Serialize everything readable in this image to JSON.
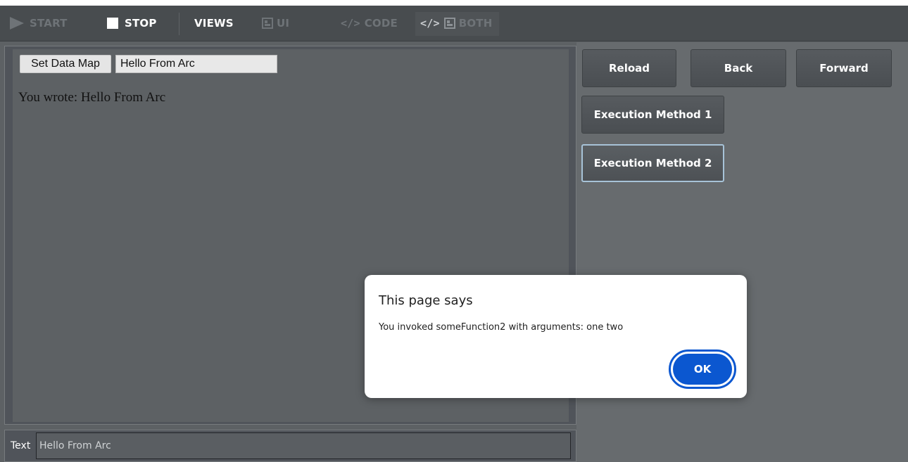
{
  "toolbar": {
    "start_label": "START",
    "stop_label": "STOP",
    "views_label": "VIEWS",
    "ui_label": "UI",
    "code_label": "CODE",
    "both_label": "BOTH",
    "code_glyph": "</>",
    "icons": [
      "play-icon",
      "stop-icon",
      "ui-layout-icon",
      "code-icon"
    ]
  },
  "web_view": {
    "set_button_label": "Set Data Map",
    "input_value": "Hello From Arc",
    "output_text": "You wrote: Hello From Arc"
  },
  "text_bar": {
    "label": "Text",
    "value": "Hello From Arc"
  },
  "right_panel": {
    "reload_label": "Reload",
    "back_label": "Back",
    "forward_label": "Forward",
    "exec1_label": "Execution Method 1",
    "exec2_label": "Execution Method 2"
  },
  "dialog": {
    "title": "This page says",
    "message": "You invoked someFunction2 with arguments: one two",
    "ok_label": "OK",
    "accent_color": "#0b57d0"
  }
}
